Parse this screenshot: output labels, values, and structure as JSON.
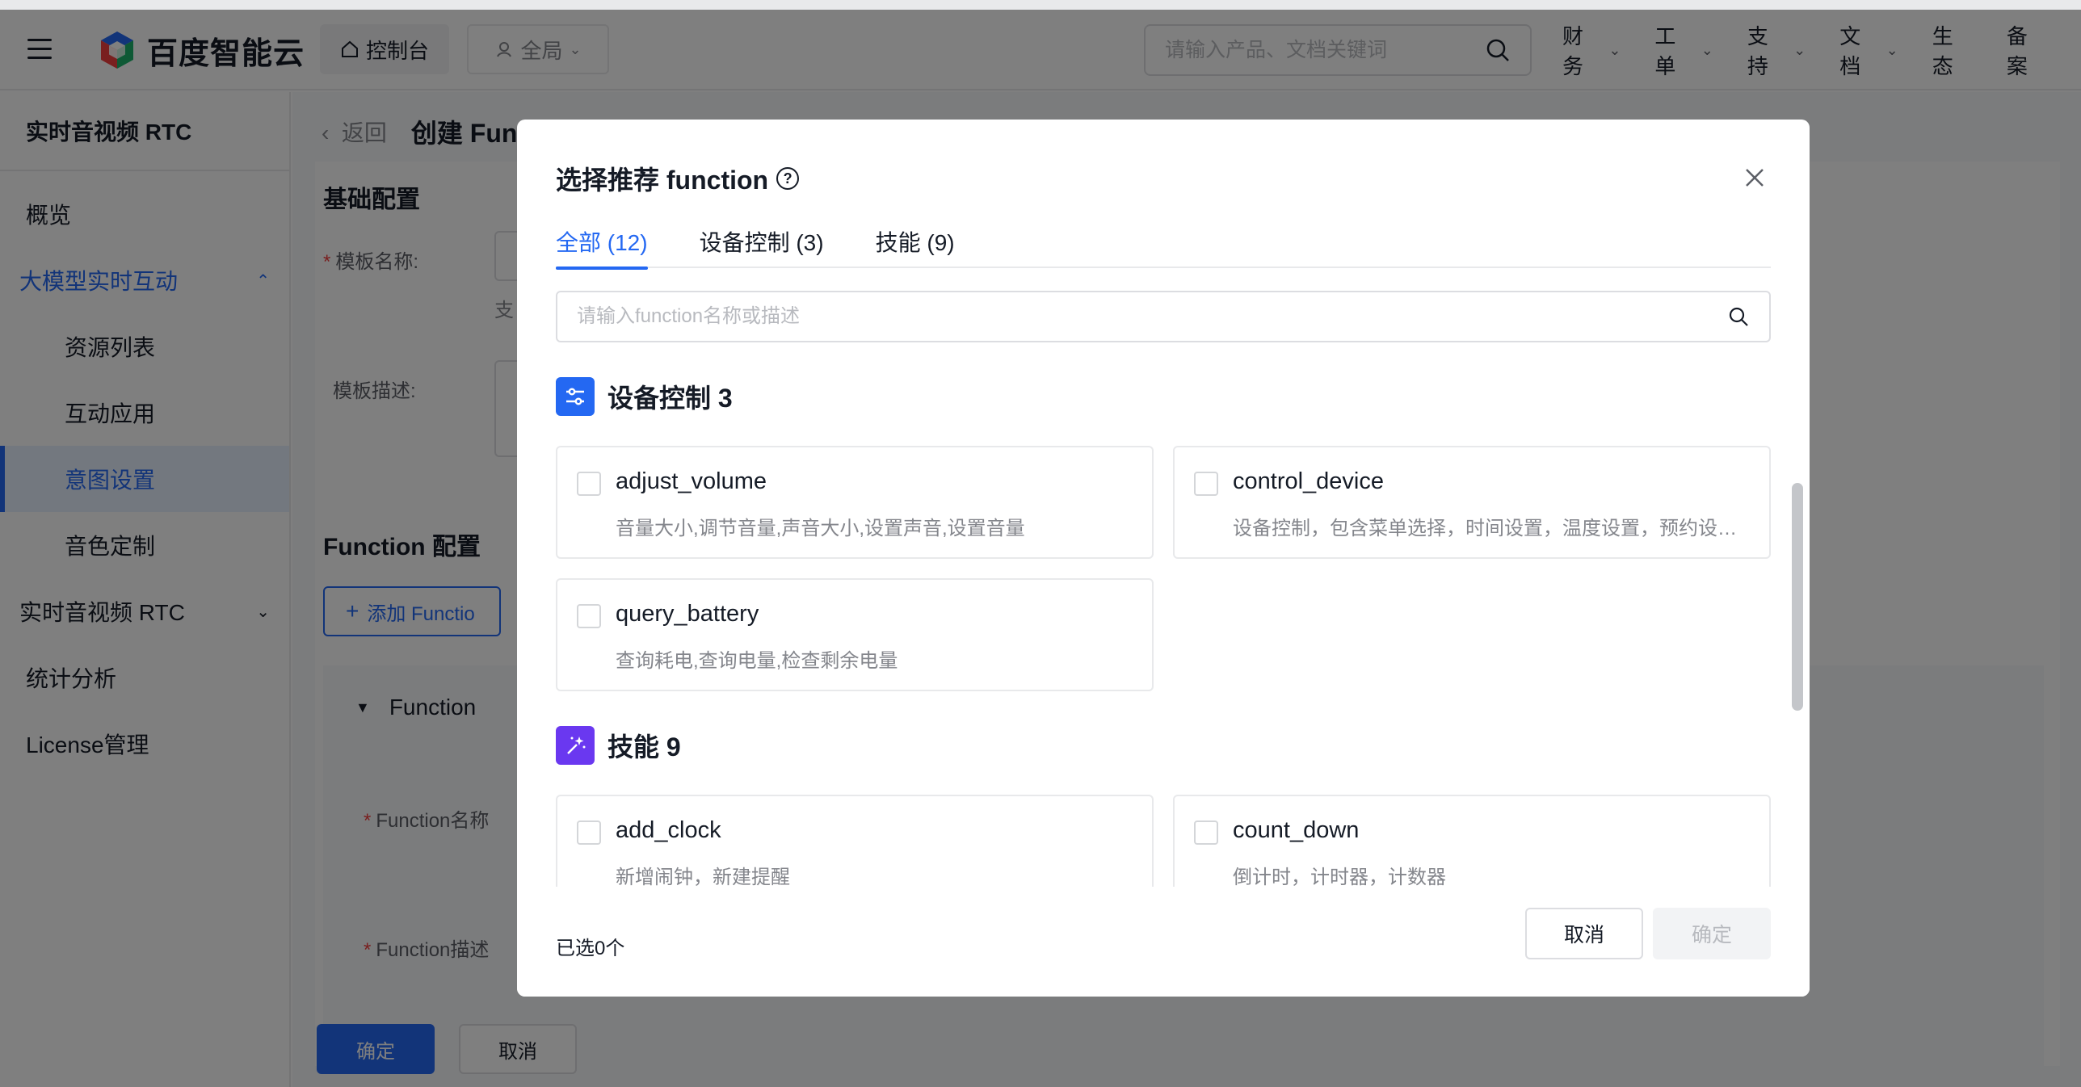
{
  "header": {
    "brand": "百度智能云",
    "console_label": "控制台",
    "region_label": "全局",
    "search_placeholder": "请输入产品、文档关键词",
    "nav": [
      "财务",
      "工单",
      "支持",
      "文档",
      "生态",
      "备案"
    ]
  },
  "sidebar": {
    "title": "实时音视频 RTC",
    "items": [
      {
        "label": "概览"
      },
      {
        "label": "大模型实时互动"
      },
      {
        "label": "资源列表"
      },
      {
        "label": "互动应用"
      },
      {
        "label": "意图设置"
      },
      {
        "label": "音色定制"
      },
      {
        "label": "实时音视频 RTC"
      },
      {
        "label": "统计分析"
      },
      {
        "label": "License管理"
      }
    ]
  },
  "page": {
    "back_label": "返回",
    "title": "创建 Fun",
    "basic_section": "基础配置",
    "template_name_label": "模板名称:",
    "template_desc_label": "模板描述:",
    "hint_fragment": "支",
    "function_section": "Function 配置",
    "add_function_label": "添加 Functio",
    "function_panel_label": "Function",
    "function_name_label": "Function名称",
    "function_desc_label": "Function描述",
    "confirm_label": "确定",
    "cancel_label": "取消"
  },
  "modal": {
    "title": "选择推荐 function",
    "tabs": [
      {
        "label": "全部 (12)"
      },
      {
        "label": "设备控制 (3)"
      },
      {
        "label": "技能 (9)"
      }
    ],
    "search_placeholder": "请输入function名称或描述",
    "groups": [
      {
        "title": "设备控制 3",
        "color": "#2468f2",
        "items": [
          {
            "name": "adjust_volume",
            "desc": "音量大小,调节音量,声音大小,设置声音,设置音量"
          },
          {
            "name": "control_device",
            "desc": "设备控制，包含菜单选择，时间设置，温度设置，预约设置，模式设置"
          },
          {
            "name": "query_battery",
            "desc": "查询耗电,查询电量,检查剩余电量"
          }
        ]
      },
      {
        "title": "技能 9",
        "color": "#6a38f0",
        "items": [
          {
            "name": "add_clock",
            "desc": "新增闹钟，新建提醒"
          },
          {
            "name": "count_down",
            "desc": "倒计时，计时器，计数器"
          }
        ]
      }
    ],
    "selected_count": "已选0个",
    "cancel_label": "取消",
    "ok_label": "确定"
  },
  "colors": {
    "primary": "#2468f2",
    "skill": "#6a38f0",
    "danger": "#f33e3e"
  }
}
